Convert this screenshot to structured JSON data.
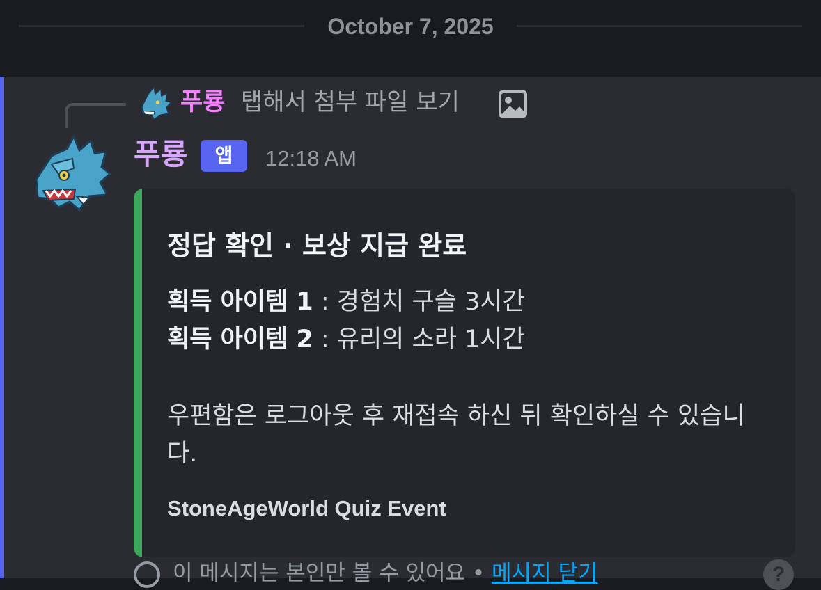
{
  "date_divider": "October 7, 2025",
  "reply": {
    "author": "푸룡",
    "text": "탭해서 첨부 파일 보기",
    "attachment_icon": "image-icon"
  },
  "message": {
    "author": "푸룡",
    "badge": "앱",
    "timestamp": "12:18 AM",
    "author_color": "#d9a6ff"
  },
  "embed": {
    "accent_color": "#3ba55c",
    "title": "정답 확인 · 보상 지급 완료",
    "items": [
      {
        "label": "획득 아이템 1",
        "value": " : 경험치 구슬 3시간"
      },
      {
        "label": "획득 아이템 2",
        "value": " : 유리의 소라 1시간"
      }
    ],
    "notice": "우편함은 로그아웃 후 재접속 하신 뒤 확인하실 수 있습니다.",
    "footer": "StoneAgeWorld Quiz Event"
  },
  "ephemeral": {
    "text": "이 메시지는 본인만 볼 수 있어요 • ",
    "dismiss_label": "메시지 닫기",
    "help": "?"
  }
}
